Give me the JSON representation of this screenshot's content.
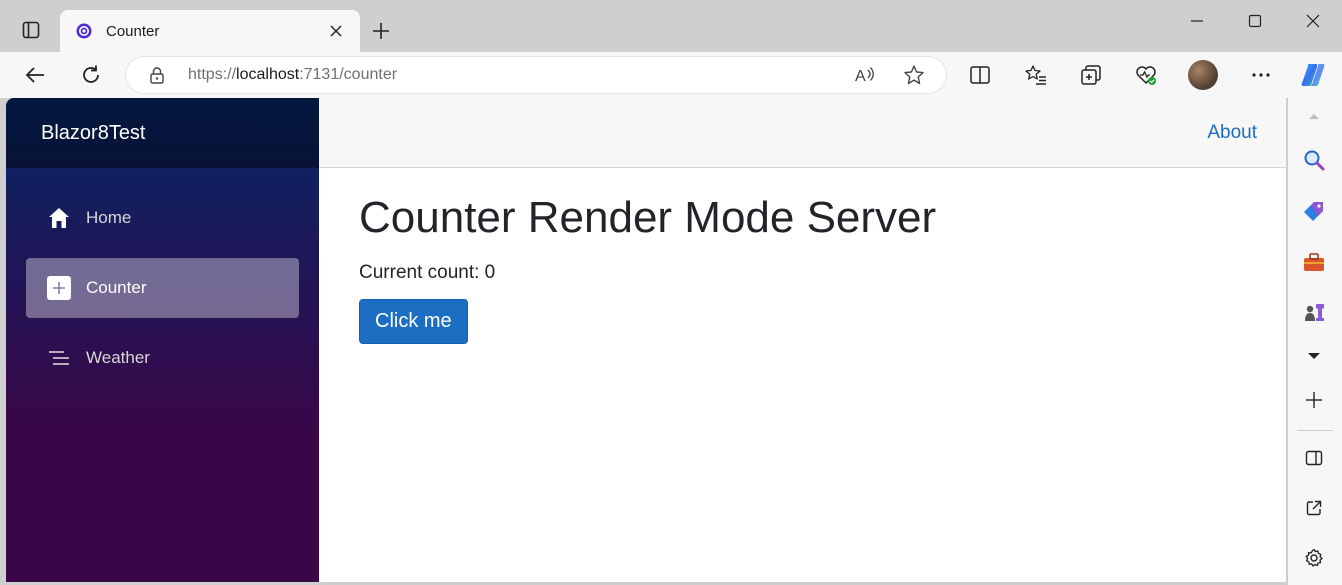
{
  "browser": {
    "tab_title": "Counter",
    "url_scheme": "https://",
    "url_host": "localhost",
    "url_rest": ":7131/counter",
    "icons": [
      "tab-actions-icon",
      "blazor-favicon",
      "close-icon",
      "plus-icon",
      "minimize-icon",
      "maximize-icon",
      "window-close-icon",
      "back-icon",
      "refresh-icon",
      "lock-icon",
      "read-aloud-icon",
      "favorite-star-icon",
      "split-screen-icon",
      "favorites-icon",
      "collections-icon",
      "browser-essentials-icon",
      "profile-avatar",
      "more-icon",
      "copilot-icon"
    ]
  },
  "app": {
    "brand": "Blazor8Test",
    "nav": [
      {
        "label": "Home",
        "icon": "home-icon",
        "active": false
      },
      {
        "label": "Counter",
        "icon": "plus-square-icon",
        "active": true
      },
      {
        "label": "Weather",
        "icon": "list-icon",
        "active": false
      }
    ],
    "about_link": "About",
    "page_title": "Counter Render Mode Server",
    "current_count": "Current count: 0",
    "button_label": "Click me",
    "colors": {
      "sidebar_top": "#052767",
      "sidebar_bottom": "#3a0647",
      "primary": "#1b6ec2"
    }
  },
  "edge_sidebar": {
    "icons": [
      "scroll-up-icon",
      "search-icon",
      "shopping-tag-icon",
      "tools-icon",
      "games-icon",
      "chevron-down-icon",
      "add-icon",
      "sidebar-panel-icon",
      "open-external-icon",
      "settings-gear-icon"
    ]
  }
}
